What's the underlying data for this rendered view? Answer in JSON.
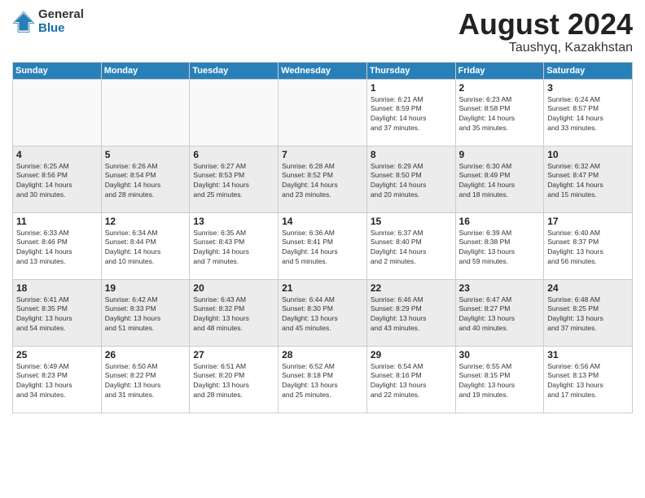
{
  "logo": {
    "general": "General",
    "blue": "Blue"
  },
  "header": {
    "month": "August 2024",
    "location": "Taushyq, Kazakhstan"
  },
  "weekdays": [
    "Sunday",
    "Monday",
    "Tuesday",
    "Wednesday",
    "Thursday",
    "Friday",
    "Saturday"
  ],
  "weeks": [
    [
      {
        "day": "",
        "info": ""
      },
      {
        "day": "",
        "info": ""
      },
      {
        "day": "",
        "info": ""
      },
      {
        "day": "",
        "info": ""
      },
      {
        "day": "1",
        "info": "Sunrise: 6:21 AM\nSunset: 8:59 PM\nDaylight: 14 hours\nand 37 minutes."
      },
      {
        "day": "2",
        "info": "Sunrise: 6:23 AM\nSunset: 8:58 PM\nDaylight: 14 hours\nand 35 minutes."
      },
      {
        "day": "3",
        "info": "Sunrise: 6:24 AM\nSunset: 8:57 PM\nDaylight: 14 hours\nand 33 minutes."
      }
    ],
    [
      {
        "day": "4",
        "info": "Sunrise: 6:25 AM\nSunset: 8:56 PM\nDaylight: 14 hours\nand 30 minutes."
      },
      {
        "day": "5",
        "info": "Sunrise: 6:26 AM\nSunset: 8:54 PM\nDaylight: 14 hours\nand 28 minutes."
      },
      {
        "day": "6",
        "info": "Sunrise: 6:27 AM\nSunset: 8:53 PM\nDaylight: 14 hours\nand 25 minutes."
      },
      {
        "day": "7",
        "info": "Sunrise: 6:28 AM\nSunset: 8:52 PM\nDaylight: 14 hours\nand 23 minutes."
      },
      {
        "day": "8",
        "info": "Sunrise: 6:29 AM\nSunset: 8:50 PM\nDaylight: 14 hours\nand 20 minutes."
      },
      {
        "day": "9",
        "info": "Sunrise: 6:30 AM\nSunset: 8:49 PM\nDaylight: 14 hours\nand 18 minutes."
      },
      {
        "day": "10",
        "info": "Sunrise: 6:32 AM\nSunset: 8:47 PM\nDaylight: 14 hours\nand 15 minutes."
      }
    ],
    [
      {
        "day": "11",
        "info": "Sunrise: 6:33 AM\nSunset: 8:46 PM\nDaylight: 14 hours\nand 13 minutes."
      },
      {
        "day": "12",
        "info": "Sunrise: 6:34 AM\nSunset: 8:44 PM\nDaylight: 14 hours\nand 10 minutes."
      },
      {
        "day": "13",
        "info": "Sunrise: 6:35 AM\nSunset: 8:43 PM\nDaylight: 14 hours\nand 7 minutes."
      },
      {
        "day": "14",
        "info": "Sunrise: 6:36 AM\nSunset: 8:41 PM\nDaylight: 14 hours\nand 5 minutes."
      },
      {
        "day": "15",
        "info": "Sunrise: 6:37 AM\nSunset: 8:40 PM\nDaylight: 14 hours\nand 2 minutes."
      },
      {
        "day": "16",
        "info": "Sunrise: 6:39 AM\nSunset: 8:38 PM\nDaylight: 13 hours\nand 59 minutes."
      },
      {
        "day": "17",
        "info": "Sunrise: 6:40 AM\nSunset: 8:37 PM\nDaylight: 13 hours\nand 56 minutes."
      }
    ],
    [
      {
        "day": "18",
        "info": "Sunrise: 6:41 AM\nSunset: 8:35 PM\nDaylight: 13 hours\nand 54 minutes."
      },
      {
        "day": "19",
        "info": "Sunrise: 6:42 AM\nSunset: 8:33 PM\nDaylight: 13 hours\nand 51 minutes."
      },
      {
        "day": "20",
        "info": "Sunrise: 6:43 AM\nSunset: 8:32 PM\nDaylight: 13 hours\nand 48 minutes."
      },
      {
        "day": "21",
        "info": "Sunrise: 6:44 AM\nSunset: 8:30 PM\nDaylight: 13 hours\nand 45 minutes."
      },
      {
        "day": "22",
        "info": "Sunrise: 6:46 AM\nSunset: 8:29 PM\nDaylight: 13 hours\nand 43 minutes."
      },
      {
        "day": "23",
        "info": "Sunrise: 6:47 AM\nSunset: 8:27 PM\nDaylight: 13 hours\nand 40 minutes."
      },
      {
        "day": "24",
        "info": "Sunrise: 6:48 AM\nSunset: 8:25 PM\nDaylight: 13 hours\nand 37 minutes."
      }
    ],
    [
      {
        "day": "25",
        "info": "Sunrise: 6:49 AM\nSunset: 8:23 PM\nDaylight: 13 hours\nand 34 minutes."
      },
      {
        "day": "26",
        "info": "Sunrise: 6:50 AM\nSunset: 8:22 PM\nDaylight: 13 hours\nand 31 minutes."
      },
      {
        "day": "27",
        "info": "Sunrise: 6:51 AM\nSunset: 8:20 PM\nDaylight: 13 hours\nand 28 minutes."
      },
      {
        "day": "28",
        "info": "Sunrise: 6:52 AM\nSunset: 8:18 PM\nDaylight: 13 hours\nand 25 minutes."
      },
      {
        "day": "29",
        "info": "Sunrise: 6:54 AM\nSunset: 8:16 PM\nDaylight: 13 hours\nand 22 minutes."
      },
      {
        "day": "30",
        "info": "Sunrise: 6:55 AM\nSunset: 8:15 PM\nDaylight: 13 hours\nand 19 minutes."
      },
      {
        "day": "31",
        "info": "Sunrise: 6:56 AM\nSunset: 8:13 PM\nDaylight: 13 hours\nand 17 minutes."
      }
    ]
  ]
}
